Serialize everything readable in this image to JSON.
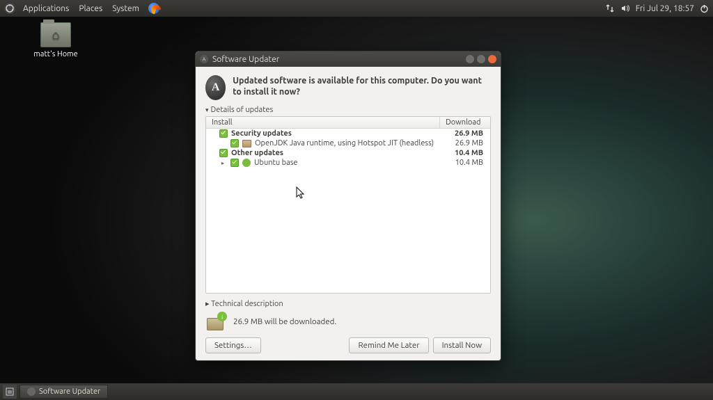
{
  "topbar": {
    "menus": [
      "Applications",
      "Places",
      "System"
    ],
    "datetime": "Fri Jul 29, 18:57"
  },
  "desktop": {
    "home_label": "matt's Home"
  },
  "window": {
    "title": "Software Updater",
    "heading": "Updated software is available for this computer. Do you want to install it now?",
    "details_label": "Details of updates",
    "columns": {
      "install": "Install",
      "download": "Download"
    },
    "groups": [
      {
        "name": "Security updates",
        "size": "26.9 MB",
        "expandable": false,
        "items": [
          {
            "name": "OpenJDK Java runtime, using Hotspot JIT (headless)",
            "size": "26.9 MB",
            "icon": "pkg"
          }
        ]
      },
      {
        "name": "Other updates",
        "size": "10.4 MB",
        "expandable": false,
        "items": [
          {
            "name": "Ubuntu base",
            "size": "10.4 MB",
            "icon": "ubu",
            "expandable": true
          }
        ]
      }
    ],
    "tech_label": "Technical description",
    "download_summary": "26.9 MB will be downloaded.",
    "buttons": {
      "settings": "Settings…",
      "remind": "Remind Me Later",
      "install": "Install Now"
    }
  },
  "taskbar": {
    "task": "Software Updater"
  }
}
